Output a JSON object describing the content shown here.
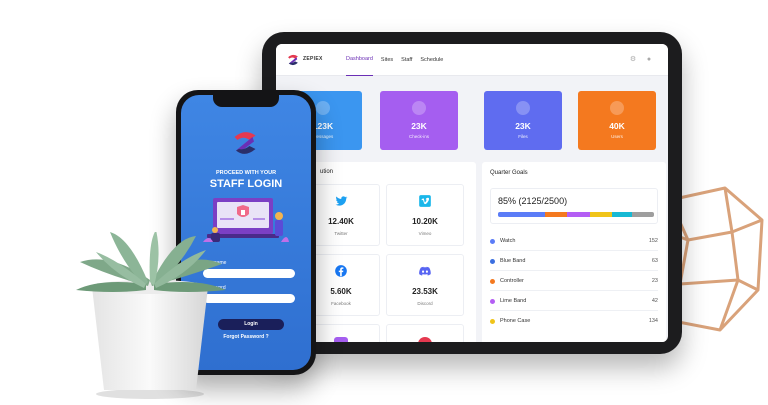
{
  "tablet": {
    "brand": "ZEPIEX",
    "nav": [
      "Dashboard",
      "Sites",
      "Staff",
      "Schedule"
    ],
    "active_nav": "Dashboard",
    "stats": [
      {
        "value": "123K",
        "label": "Messages",
        "color": "#3b96f0",
        "icon": "envelope-icon"
      },
      {
        "value": "23K",
        "label": "Check-ins",
        "color": "#a55ef0",
        "icon": "location-pin-icon"
      },
      {
        "value": "23K",
        "label": "Files",
        "color": "#5f6cf0",
        "icon": "file-icon"
      },
      {
        "value": "40K",
        "label": "Users",
        "color": "#f4791f",
        "icon": "users-icon"
      }
    ],
    "distribution": {
      "title": "ution",
      "cards": [
        {
          "value": "12.40K",
          "label": "Twitter",
          "icon": "twitter-icon",
          "color": "#1da1f2"
        },
        {
          "value": "10.20K",
          "label": "Vimeo",
          "icon": "vimeo-icon",
          "color": "#1ab7ea"
        },
        {
          "value": "5.60K",
          "label": "Facebook",
          "icon": "facebook-icon",
          "color": "#1877f2"
        },
        {
          "value": "23.53K",
          "label": "Discord",
          "icon": "discord-icon",
          "color": "#5865f2"
        }
      ]
    },
    "quarter_goals": {
      "title": "Quarter Goals",
      "percent": "85%",
      "detail": "(2125/2500)",
      "segments": [
        {
          "color": "#5b7cf7",
          "share": 0.3
        },
        {
          "color": "#f4791f",
          "share": 0.14
        },
        {
          "color": "#b45ef4",
          "share": 0.15
        },
        {
          "color": "#f0c419",
          "share": 0.14
        },
        {
          "color": "#17b9d4",
          "share": 0.13
        },
        {
          "color": "#9e9e9e",
          "share": 0.14
        }
      ],
      "items": [
        {
          "name": "Watch",
          "count": "152",
          "color": "#5b7cf7"
        },
        {
          "name": "Blue Band",
          "count": "63",
          "color": "#3b6fe0"
        },
        {
          "name": "Controller",
          "count": "23",
          "color": "#f4791f"
        },
        {
          "name": "Lime Band",
          "count": "42",
          "color": "#b45ef4"
        },
        {
          "name": "Phone Case",
          "count": "134",
          "color": "#f0c419"
        }
      ]
    }
  },
  "phone": {
    "subtitle": "PROCEED WITH YOUR",
    "title": "STAFF LOGIN",
    "username_label": "sername",
    "password_label": "assword",
    "login_button": "Login",
    "forgot": "Forgot Password ?"
  }
}
